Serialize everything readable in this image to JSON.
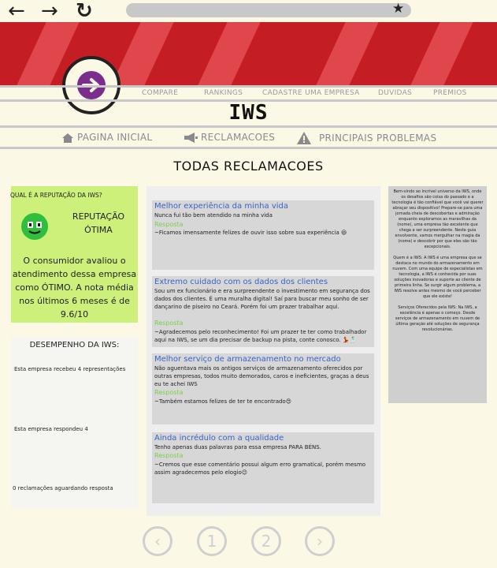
{
  "browser": {
    "back_icon": "←",
    "forward_icon": "→",
    "reload_icon": "↻",
    "star_icon": "★"
  },
  "topnav": [
    "COMPARE",
    "RANKINGS",
    "CADASTRE UMA EMPRESA",
    "DUVIDAS",
    "PREMIOS"
  ],
  "brand": "IWS",
  "subnav": [
    {
      "label": "PAGINA INICIAL",
      "icon": "home-icon"
    },
    {
      "label": "RECLAMACOES",
      "icon": "megaphone-icon"
    },
    {
      "label": "PRINCIPAIS PROBLEMAS",
      "icon": "warning-icon"
    }
  ],
  "page_title": "TODAS RECLAMACOES",
  "reputation": {
    "question": "QUAL É A REPUTAÇÃO DA IWS?",
    "status": "REPUTAÇÃO ÓTIMA",
    "text": "O consumidor avaliou o atendimento dessa empresa como ÓTIMO. A nota média nos últimos 6 meses é de 9.6/10"
  },
  "performance": {
    "title": "DESEMPENHO DA IWS:",
    "stats": [
      "Esta empresa recebeu 4 representações",
      "Esta empresa respondeu 4",
      "0 reclamações aguardando resposta"
    ]
  },
  "complaints": [
    {
      "title": "Melhor experiência da minha vida",
      "body": "Nunca fui tão bem atendido na minha vida",
      "response_label": "Resposta",
      "response": "~Ficamos imensamente felizes de ouvir isso sobre sua experiência 😃"
    },
    {
      "title": "Extremo cuidado com os dados dos clientes",
      "body": "Sou um ex funcionário e era surpreendente o investimento em segurança dos dados dos clientes. É uma muralha digital! Saí para buscar meu sonho de ser dançarino de piseiro no Ceará. Porém foi um prazer trabalhar aqui.",
      "response_label": "Resposta",
      "response": "~Agradecemos pelo reconhecimento! Foi um prazer te ter como trabalhador aqui na IWS, se um dia precisar de backup na pista, conte conosco. 💃🕺"
    },
    {
      "title": "Melhor serviço de armazenamento no mercado",
      "body": "Não aguentava mais os antigos serviços de armazenamento oferecidos por outras empresas, todos muito demorados, caros e ineficientes, graças a deus eu te achei IWS",
      "response_label": "Resposta",
      "response": "~Também estamos felizes de ter te encontrado😍"
    },
    {
      "title": "Ainda incrédulo com a qualidade",
      "body": "Tenho apenas duas palavras para essa empresa PARA BÉNS.",
      "response_label": "Resposta",
      "response": "~Cremos que esse comentário possui algum erro gramatical, porém mesmo assim agradecemos pelo elogio😉"
    }
  ],
  "info": [
    "Bem-vindo ao incrível universo da IWS, onde os desafios são coisa do passado e a tecnologia é tão confiável que você vai querer abraçar seu dispositivo! Prepare-se para uma jornada cheia de descobertas e admiração enquanto exploramos as maravilhas da (nome), uma empresa tão excelente que chega a ser surpreendente. Neste guia envolvente, vamos mergulhar na magia da (nome) e descobrir por que eles são tão excepcionais.",
    "Quem é a IWS: A IWS é uma empresa que se destaca no mundo do armazenamento em nuvem. Com uma equipe de especialistas em tecnologia, a IWS é conhecida por suas soluções inovadoras e suporte ao cliente de primeira linha. Se surgir algum problema, a IWS resolve antes mesmo de você perceber que ele existe!",
    "Serviços Oferecidos pela IWS: Na IWS, a excelência é apenas o começo. Desde serviços de armazenamento em nuvem de última geração até soluções de segurança revolucionárias."
  ],
  "pagination": {
    "prev_icon": "‹",
    "pages": [
      "1",
      "2"
    ],
    "next_icon": "›"
  },
  "colors": {
    "banner_red": "#c41e24",
    "stripe_red": "#e0474c",
    "logo_purple": "#7b2d8e",
    "reputation_green": "#ccf07a",
    "link_blue": "#3b62c6",
    "response_green": "#7ad04a"
  }
}
